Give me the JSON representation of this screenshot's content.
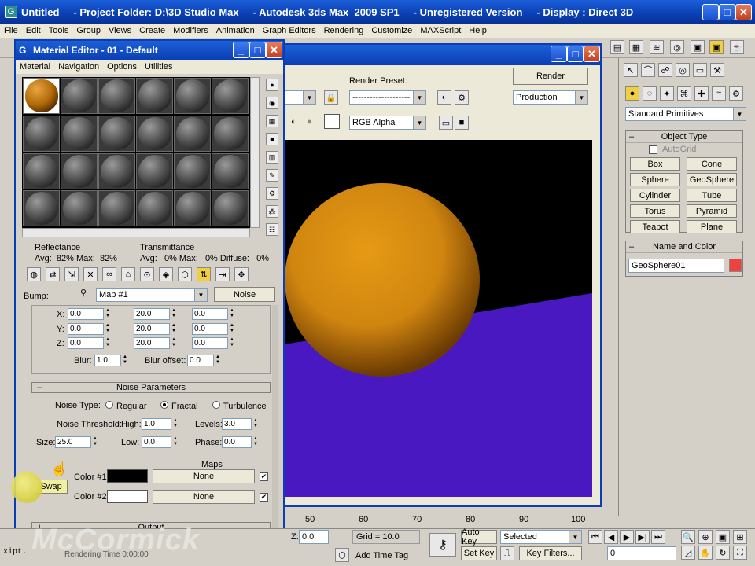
{
  "main_window": {
    "title": "Untitled     - Project Folder: D:\\3D Studio Max     - Autodesk 3ds Max  2009 SP1     - Unregistered Version     - Display : Direct 3D",
    "menu": [
      "File",
      "Edit",
      "Tools",
      "Group",
      "Views",
      "Create",
      "Modifiers",
      "Animation",
      "Graph Editors",
      "Rendering",
      "Customize",
      "MAXScript",
      "Help"
    ]
  },
  "render_window": {
    "render_preset_label": "Render Preset:",
    "render_preset_value": "--------------------",
    "render_button": "Render",
    "production_value": "Production",
    "channel_value": "RGB Alpha"
  },
  "material_editor": {
    "title": "Material Editor - 01 - Default",
    "menu": [
      "Material",
      "Navigation",
      "Options",
      "Utilities"
    ],
    "reflectance_label": "Reflectance",
    "reflectance_values": "Avg:  82% Max:  82%",
    "transmittance_label": "Transmittance",
    "transmittance_values": "Avg:   0% Max:   0% Diffuse:   0%",
    "bump_label": "Bump:",
    "bump_map": "Map #1",
    "bump_type": "Noise",
    "coords": {
      "x_label": "X:",
      "y_label": "Y:",
      "z_label": "Z:",
      "offset": [
        "0.0",
        "0.0",
        "0.0"
      ],
      "tiling": [
        "20.0",
        "20.0",
        "20.0"
      ],
      "angle": [
        "0.0",
        "0.0",
        "0.0"
      ],
      "blur_label": "Blur:",
      "blur": "1.0",
      "blur_offset_label": "Blur offset:",
      "blur_offset": "0.0"
    },
    "noise_header": "Noise Parameters",
    "noise_type_label": "Noise Type:",
    "noise_types": [
      "Regular",
      "Fractal",
      "Turbulence"
    ],
    "noise_threshold_label": "Noise Threshold:",
    "high_label": "High:",
    "high": "1.0",
    "levels_label": "Levels:",
    "levels": "3.0",
    "size_label": "Size:",
    "size": "25.0",
    "low_label": "Low:",
    "low": "0.0",
    "phase_label": "Phase:",
    "phase": "0.0",
    "maps_label": "Maps",
    "color1_label": "Color #1",
    "color1_map": "None",
    "color1": "#000000",
    "color2_label": "Color #2",
    "color2_map": "None",
    "color2": "#ffffff",
    "swap_label": "Swap",
    "output_label": "Output"
  },
  "command_panel": {
    "category": "Standard Primitives",
    "object_type_header": "Object Type",
    "autogrid_label": "AutoGrid",
    "buttons": [
      "Box",
      "Cone",
      "Sphere",
      "GeoSphere",
      "Cylinder",
      "Tube",
      "Torus",
      "Pyramid",
      "Teapot",
      "Plane"
    ],
    "name_color_header": "Name and Color",
    "object_name": "GeoSphere01",
    "object_color": "#f04040"
  },
  "timeline": {
    "ticks": [
      "50",
      "60",
      "70",
      "80",
      "90",
      "100"
    ]
  },
  "status_bar": {
    "z_label": "Z:",
    "z_value": "0.0",
    "grid_label": "Grid = 10.0",
    "add_time_tag": "Add Time Tag",
    "auto_key": "Auto Key",
    "set_key": "Set Key",
    "selected_value": "Selected",
    "key_filters": "Key Filters...",
    "frame_value": "0",
    "rendering_time": "Rendering Time  0:00:00",
    "maxscript_prompt": "xipt."
  },
  "watermark": "McCormick",
  "colors": {
    "sphere": "#d98c10",
    "floor": "#4a18c0",
    "title_blue": "#0a3fb4"
  }
}
